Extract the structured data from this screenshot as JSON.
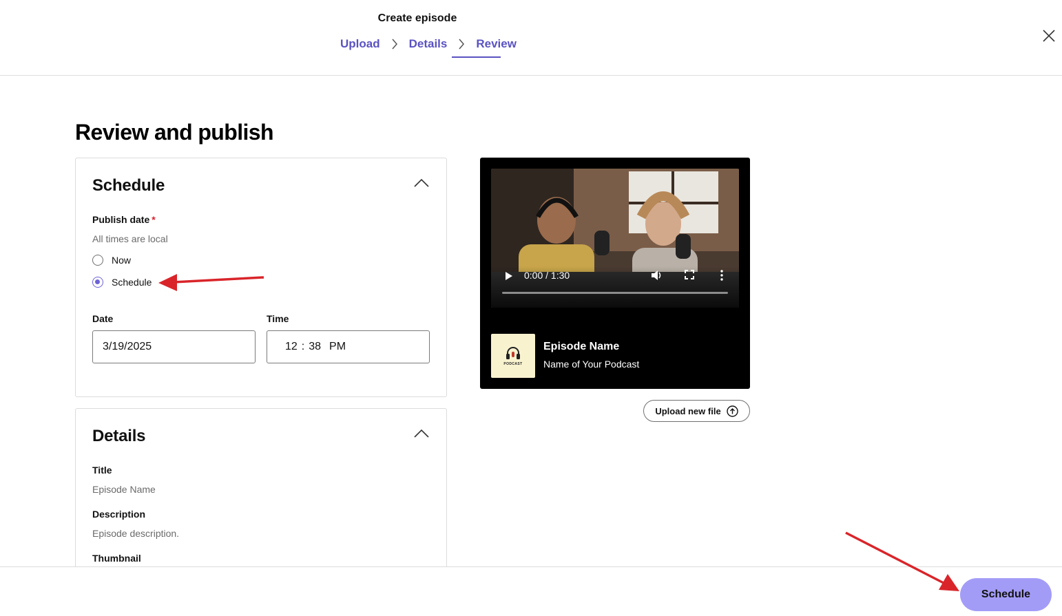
{
  "header": {
    "title": "Create episode",
    "steps": [
      {
        "label": "Upload"
      },
      {
        "label": "Details"
      },
      {
        "label": "Review",
        "active": true
      }
    ]
  },
  "page": {
    "title": "Review and publish"
  },
  "schedule_card": {
    "heading": "Schedule",
    "publish_date_label": "Publish date",
    "required_mark": "*",
    "hint": "All times are local",
    "options": [
      {
        "label": "Now",
        "selected": false
      },
      {
        "label": "Schedule",
        "selected": true
      }
    ],
    "date_label": "Date",
    "date_value": "3/19/2025",
    "time_label": "Time",
    "time_hour": "12",
    "time_sep": ":",
    "time_minute": "38",
    "time_ampm": "PM"
  },
  "details_card": {
    "heading": "Details",
    "title_label": "Title",
    "title_value": "Episode Name",
    "description_label": "Description",
    "description_value": "Episode description.",
    "thumbnail_label": "Thumbnail"
  },
  "preview": {
    "time_display": "0:00 / 1:30",
    "progress_fraction": 0,
    "thumbnail_text": "PODCAST",
    "episode_name": "Episode Name",
    "podcast_name": "Name of Your Podcast",
    "upload_button": "Upload new file"
  },
  "footer": {
    "primary_button": "Schedule"
  },
  "colors": {
    "accent": "#5a52c2",
    "radio_selected": "#6d63d6",
    "primary_button_bg": "#a39cf7",
    "annotation_arrow": "#d9252a",
    "required": "#d6212e"
  },
  "icons": {
    "close": "close-icon",
    "step_separator": "chevron-right-icon",
    "collapse": "chevron-up-icon",
    "play": "play-icon",
    "volume": "volume-icon",
    "fullscreen": "fullscreen-icon",
    "more": "more-vertical-icon",
    "upload": "upload-arrow-circle-icon"
  }
}
